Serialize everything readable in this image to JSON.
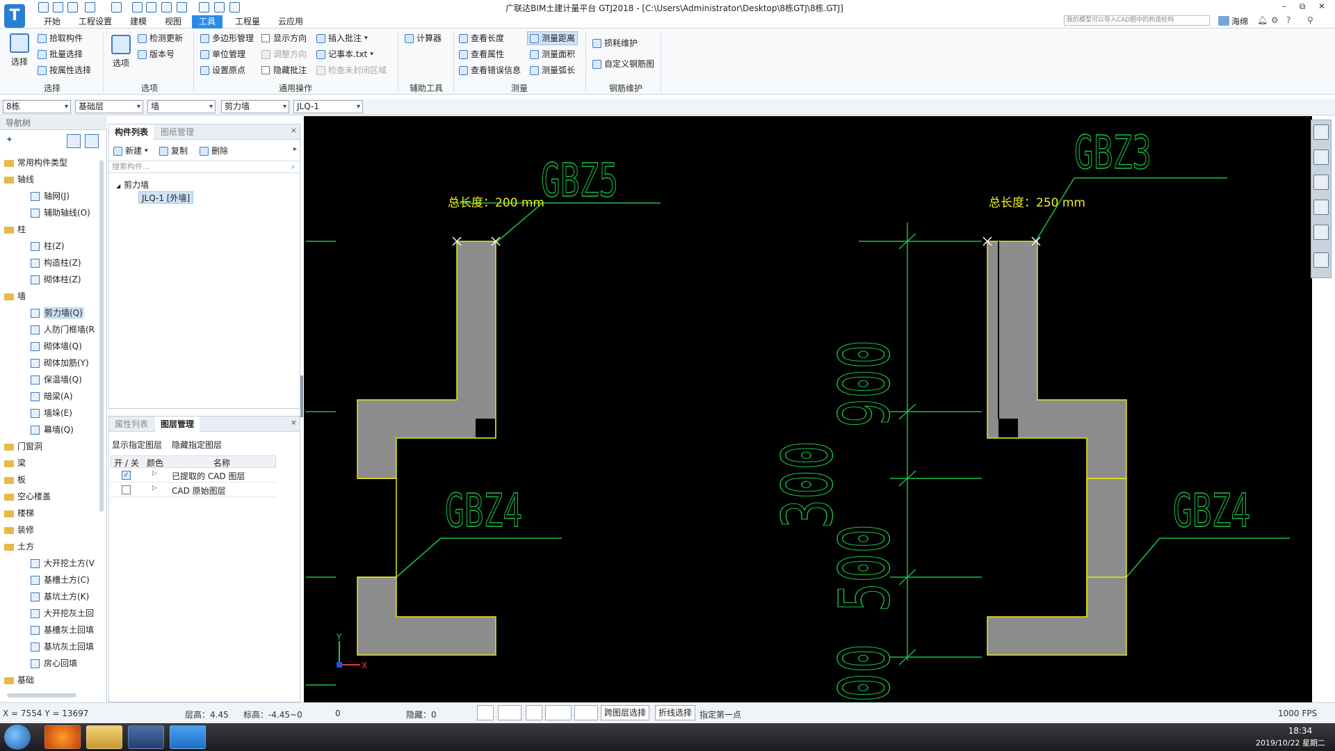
{
  "window": {
    "title": "广联达BIM土建计量平台 GTJ2018 - [C:\\Users\\Administrator\\Desktop\\8栋GTJ\\8栋.GTJ]",
    "logo": "T",
    "minimize": "–",
    "restore": "⧉",
    "close": "✕"
  },
  "menu": {
    "tabs": [
      "开始",
      "工程设置",
      "建模",
      "视图",
      "工具",
      "工程量",
      "云应用"
    ],
    "active": "工具",
    "search_placeholder": "我的模型可以导入CAD图中的构造柱吗",
    "user": "海绵"
  },
  "ribbon": {
    "select": {
      "big": "选择",
      "items": [
        "拾取构件",
        "批量选择",
        "按属性选择"
      ],
      "label": "选择"
    },
    "options": {
      "big": "选项",
      "items": [
        "检测更新",
        "版本号"
      ],
      "label": "选项"
    },
    "general": {
      "col1": [
        "多边形管理",
        "单位管理",
        "设置原点"
      ],
      "col2": [
        "显示方向",
        "调整方向",
        "隐藏批注"
      ],
      "col3": [
        "插入批注",
        "记事本.txt",
        "检查未封闭区域"
      ],
      "label": "通用操作"
    },
    "aux": {
      "items": [
        "计算器"
      ],
      "label": "辅助工具"
    },
    "measure": {
      "col1": [
        "查看长度",
        "查看属性",
        "查看错误信息"
      ],
      "col2": [
        "测量距离",
        "测量面积",
        "测量弧长"
      ],
      "label": "测量"
    },
    "rebar": {
      "items": [
        "损耗维护",
        "自定义钢筋图"
      ],
      "label": "钢筋维护"
    }
  },
  "filters": [
    "8栋",
    "基础层",
    "墙",
    "剪力墙",
    "JLQ-1"
  ],
  "nav": {
    "header": "导航树",
    "tree": [
      {
        "type": "folder",
        "label": "常用构件类型"
      },
      {
        "type": "folder",
        "label": "轴线"
      },
      {
        "type": "leaf",
        "label": "轴网(J)"
      },
      {
        "type": "leaf",
        "label": "辅助轴线(O)"
      },
      {
        "type": "folder",
        "label": "柱"
      },
      {
        "type": "leaf",
        "label": "柱(Z)"
      },
      {
        "type": "leaf",
        "label": "构造柱(Z)"
      },
      {
        "type": "leaf",
        "label": "砌体柱(Z)"
      },
      {
        "type": "folder",
        "label": "墙"
      },
      {
        "type": "leaf",
        "label": "剪力墙(Q)",
        "selected": true
      },
      {
        "type": "leaf",
        "label": "人防门框墙(R"
      },
      {
        "type": "leaf",
        "label": "砌体墙(Q)"
      },
      {
        "type": "leaf",
        "label": "砌体加筋(Y)"
      },
      {
        "type": "leaf",
        "label": "保温墙(Q)"
      },
      {
        "type": "leaf",
        "label": "暗梁(A)"
      },
      {
        "type": "leaf",
        "label": "墙垛(E)"
      },
      {
        "type": "leaf",
        "label": "幕墙(Q)"
      },
      {
        "type": "folder",
        "label": "门窗洞"
      },
      {
        "type": "folder",
        "label": "梁"
      },
      {
        "type": "folder",
        "label": "板"
      },
      {
        "type": "folder",
        "label": "空心楼盖"
      },
      {
        "type": "folder",
        "label": "楼梯"
      },
      {
        "type": "folder",
        "label": "装修"
      },
      {
        "type": "folder",
        "label": "土方"
      },
      {
        "type": "leaf",
        "label": "大开挖土方(V"
      },
      {
        "type": "leaf",
        "label": "基槽土方(C)"
      },
      {
        "type": "leaf",
        "label": "基坑土方(K)"
      },
      {
        "type": "leaf",
        "label": "大开挖灰土回"
      },
      {
        "type": "leaf",
        "label": "基槽灰土回填"
      },
      {
        "type": "leaf",
        "label": "基坑灰土回填"
      },
      {
        "type": "leaf",
        "label": "房心回填"
      },
      {
        "type": "folder",
        "label": "基础"
      }
    ]
  },
  "components": {
    "tabs": [
      "构件列表",
      "图纸管理"
    ],
    "actions": [
      "新建",
      "复制",
      "删除"
    ],
    "search_placeholder": "搜索构件...",
    "group": "剪力墙",
    "item": "JLQ-1 [外墙]"
  },
  "layers": {
    "tabs": [
      "属性列表",
      "图层管理"
    ],
    "actions": [
      "显示指定图层",
      "隐藏指定图层"
    ],
    "columns": [
      "开 / 关",
      "颜色",
      "名称"
    ],
    "rows": [
      {
        "checked": true,
        "name": "已提取的 CAD 图层"
      },
      {
        "checked": false,
        "name": "CAD 原始图层"
      }
    ]
  },
  "canvas": {
    "labels": {
      "gbz5": "GBZ5",
      "gbz3": "GBZ3",
      "gbz4_left": "GBZ4",
      "gbz4_right": "GBZ4",
      "len_left": "总长度：200 mm",
      "len_right": "总长度：250 mm",
      "dim_900": "900",
      "dim_300": "300",
      "dim_500": "500",
      "dim_00": "00",
      "axis_x": "X",
      "axis_y": "Y"
    },
    "colors": {
      "wall": "#8c8c8c",
      "outline": "#e6e61a",
      "cad": "#19c24a",
      "text": "#f2f21a"
    }
  },
  "status": {
    "coords": "X = 7554 Y = 13697",
    "floor_height": "层高：4.45",
    "elevation": "标高：-4.45~0",
    "zero": "0",
    "hidden": "隐藏：0",
    "btn_cross_layer": "跨图层选择",
    "btn_polyline": "折线选择",
    "hint": "指定第一点",
    "fps": "1000 FPS"
  },
  "taskbar": {
    "time": "18:34",
    "date": "2019/10/22 星期二"
  }
}
